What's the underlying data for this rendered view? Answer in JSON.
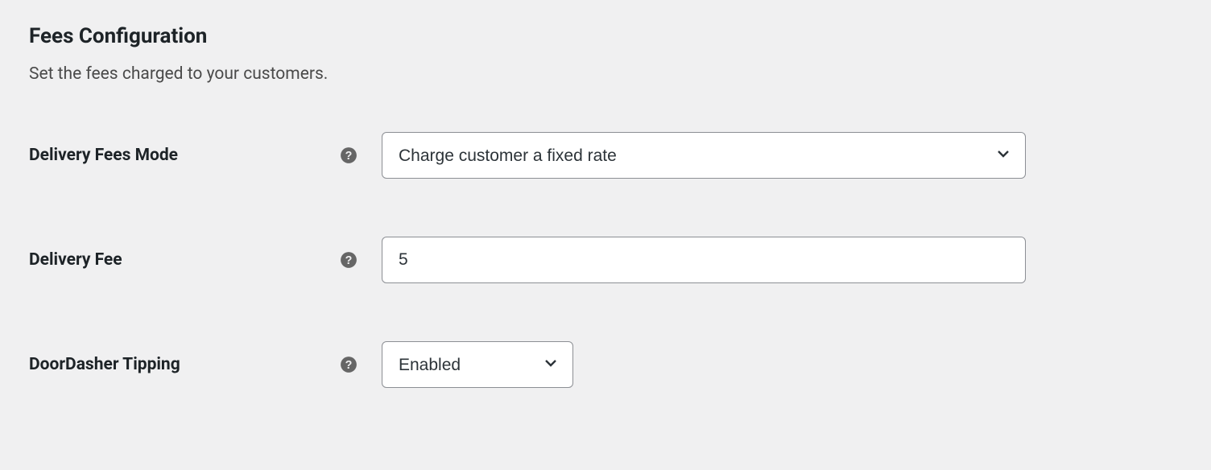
{
  "section": {
    "title": "Fees Configuration",
    "description": "Set the fees charged to your customers."
  },
  "fields": {
    "delivery_fees_mode": {
      "label": "Delivery Fees Mode",
      "value": "Charge customer a fixed rate"
    },
    "delivery_fee": {
      "label": "Delivery Fee",
      "value": "5"
    },
    "doordasher_tipping": {
      "label": "DoorDasher Tipping",
      "value": "Enabled"
    }
  }
}
